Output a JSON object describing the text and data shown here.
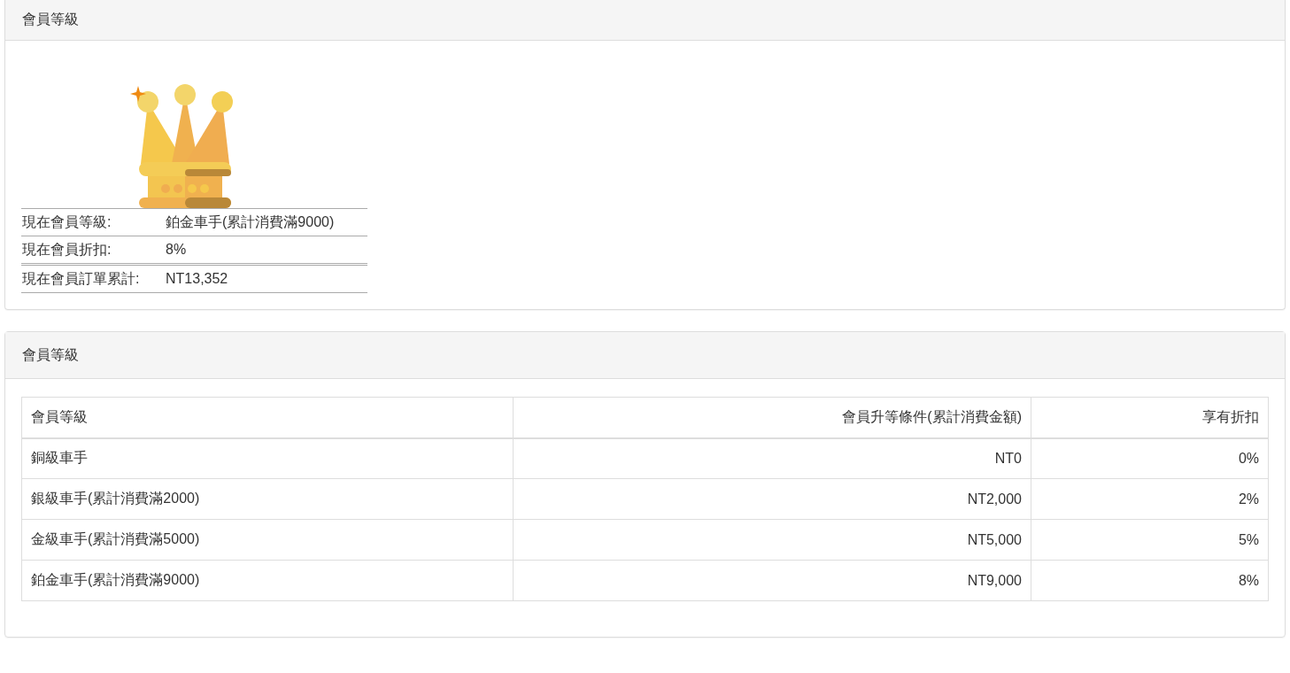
{
  "summary_panel": {
    "title": "會員等級",
    "details": [
      {
        "label": "現在會員等級:",
        "value": "鉑金車手(累計消費滿9000)"
      },
      {
        "label": "現在會員折扣:",
        "value": "8%"
      },
      {
        "label": "現在會員訂單累計:",
        "value": "NT13,352"
      }
    ]
  },
  "levels_panel": {
    "title": "會員等級",
    "table": {
      "columns": [
        "會員等級",
        "會員升等條件(累計消費金額)",
        "享有折扣"
      ],
      "rows": [
        [
          "銅級車手",
          "NT0",
          "0%"
        ],
        [
          "銀級車手(累計消費滿2000)",
          "NT2,000",
          "2%"
        ],
        [
          "金級車手(累計消費滿5000)",
          "NT5,000",
          "5%"
        ],
        [
          "鉑金車手(累計消費滿9000)",
          "NT9,000",
          "8%"
        ]
      ]
    }
  }
}
